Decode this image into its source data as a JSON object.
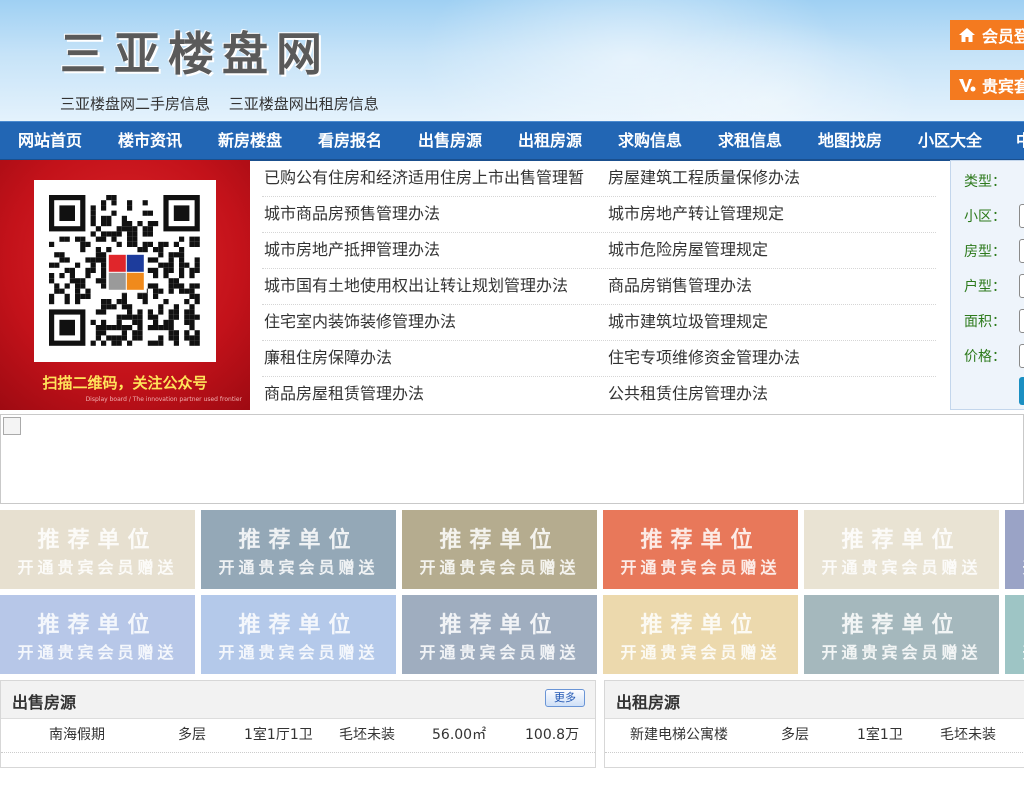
{
  "header": {
    "logo": "三亚楼盘网",
    "sublinks": [
      "三亚楼盘网二手房信息",
      "三亚楼盘网出租房信息"
    ],
    "member_login": "会员登",
    "vip_package": "贵宾套"
  },
  "nav": {
    "items": [
      "网站首页",
      "楼市资讯",
      "新房楼盘",
      "看房报名",
      "出售房源",
      "出租房源",
      "求购信息",
      "求租信息",
      "地图找房",
      "小区大全",
      "中"
    ]
  },
  "qr": {
    "caption": "扫描二维码，关注公众号",
    "tiny_text": "Display board / The innovation partner used frontier"
  },
  "news": {
    "rows": [
      [
        "已购公有住房和经济适用住房上市出售管理暂",
        "房屋建筑工程质量保修办法"
      ],
      [
        "城市商品房预售管理办法",
        "城市房地产转让管理规定"
      ],
      [
        "城市房地产抵押管理办法",
        "城市危险房屋管理规定"
      ],
      [
        "城市国有土地使用权出让转让规划管理办法",
        "商品房销售管理办法"
      ],
      [
        "住宅室内装饰装修管理办法",
        "城市建筑垃圾管理规定"
      ],
      [
        "廉租住房保障办法",
        "住宅专项维修资金管理办法"
      ],
      [
        "商品房屋租赁管理办法",
        "公共租赁住房管理办法"
      ]
    ]
  },
  "search": {
    "labels": [
      "类型：",
      "小区：",
      "房型：",
      "户型：",
      "面积：",
      "价格："
    ]
  },
  "tiles": {
    "line1": "推荐单位",
    "line2": "开通贵宾会员赠送",
    "colors_row1": [
      "#e7e0d0",
      "#94a8b7",
      "#b5ac8f",
      "#e8785a",
      "#e9e3d3",
      "#9aa3c6"
    ],
    "colors_row2": [
      "#b7c7e8",
      "#b4c9ea",
      "#9fadbf",
      "#ecd9ad",
      "#a5b8bd",
      "#9ec5c5"
    ]
  },
  "panels": {
    "sale": {
      "title": "出售房源",
      "more": "更多",
      "rows": [
        [
          "南海假期",
          "多层",
          "1室1厅1卫",
          "毛坯未装",
          "56.00㎡",
          "100.8万"
        ]
      ]
    },
    "rent": {
      "title": "出租房源",
      "rows": [
        [
          "新建电梯公寓楼",
          "多层",
          "1室1卫",
          "毛坯未装"
        ]
      ]
    }
  },
  "colors": {
    "nav_bg": "#2266b4",
    "accent_orange": "#f47a1f",
    "qr_red": "#c3121a"
  }
}
